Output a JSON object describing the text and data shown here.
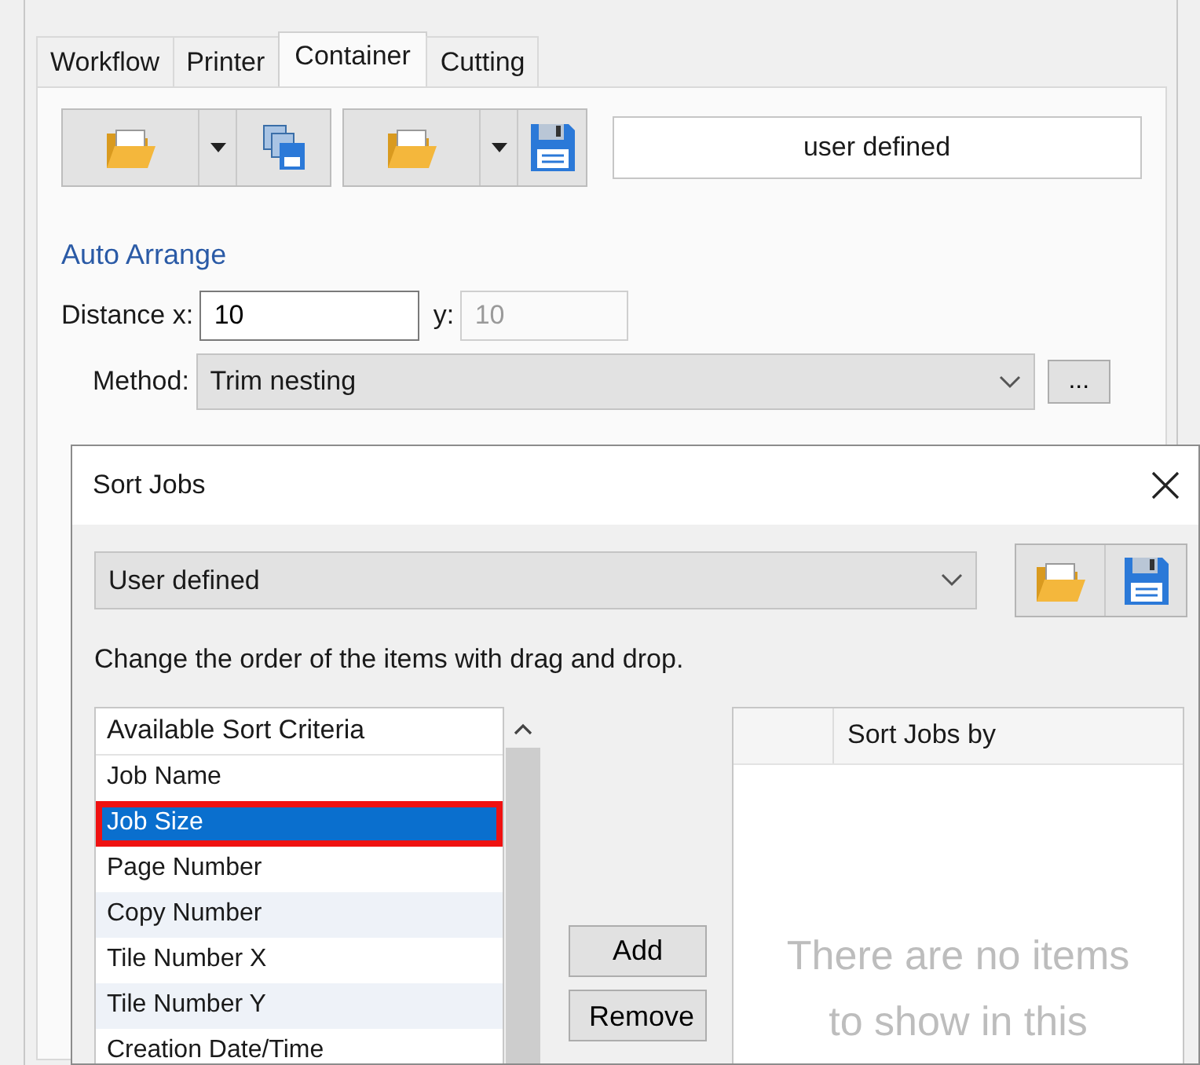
{
  "tabs": [
    {
      "label": "Workflow",
      "selected": false
    },
    {
      "label": "Printer",
      "selected": false
    },
    {
      "label": "Container",
      "selected": true
    },
    {
      "label": "Cutting",
      "selected": false
    }
  ],
  "toolbar": {
    "preset": "user defined"
  },
  "auto_arrange": {
    "heading": "Auto Arrange",
    "distance_label": "Distance x:",
    "x_value": "10",
    "y_label": "y:",
    "y_value": "10",
    "y_disabled": true,
    "method_label": "Method:",
    "method": "Trim nesting",
    "more_button": "..."
  },
  "dialog": {
    "title": "Sort Jobs",
    "preset": "User defined",
    "hint": "Change the order of the items with drag and drop.",
    "available": {
      "header": "Available Sort Criteria",
      "items": [
        {
          "label": "Job Name",
          "selected": false,
          "highlighted": false
        },
        {
          "label": "Job Size",
          "selected": true,
          "highlighted": true
        },
        {
          "label": "Page Number",
          "selected": false,
          "highlighted": false
        },
        {
          "label": "Copy Number",
          "selected": false,
          "highlighted": false
        },
        {
          "label": "Tile Number X",
          "selected": false,
          "highlighted": false
        },
        {
          "label": "Tile Number Y",
          "selected": false,
          "highlighted": false
        },
        {
          "label": "Creation Date/Time",
          "selected": false,
          "highlighted": false
        }
      ]
    },
    "buttons": [
      "Add",
      "Remove"
    ],
    "sort_by": {
      "header": "Sort Jobs by",
      "empty_text": "There are no items to show in this"
    }
  }
}
